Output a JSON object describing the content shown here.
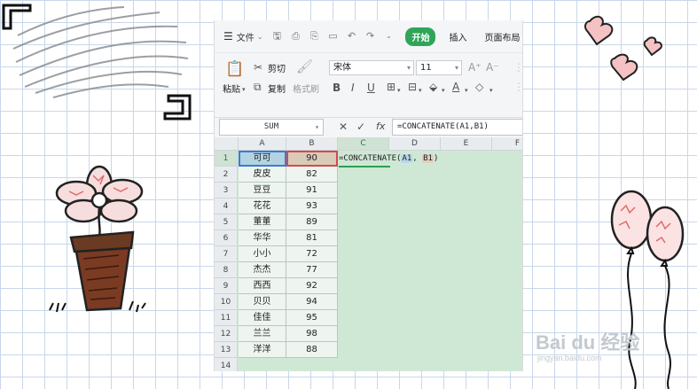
{
  "menubar": {
    "file_menu": "文件",
    "tabs": [
      {
        "label": "开始",
        "active": true
      },
      {
        "label": "插入",
        "active": false
      },
      {
        "label": "页面布局",
        "active": false
      }
    ],
    "quick_icons": [
      "save-icon",
      "print-preview-icon",
      "print-icon",
      "export-pdf-icon",
      "undo-icon",
      "redo-icon",
      "more-icon"
    ]
  },
  "ribbon": {
    "paste": "粘贴",
    "cut": "剪切",
    "copy": "复制",
    "format_painter": "格式刷",
    "font_name": "宋体",
    "font_size": "11"
  },
  "formula_bar": {
    "name_box": "SUM",
    "fx": "fx",
    "formula": "=CONCATENATE(A1,B1)"
  },
  "grid": {
    "columns": [
      "A",
      "B",
      "C",
      "D",
      "E",
      "F"
    ],
    "rows": [
      {
        "num": "1",
        "name": "可可",
        "score": "90"
      },
      {
        "num": "2",
        "name": "皮皮",
        "score": "82"
      },
      {
        "num": "3",
        "name": "豆豆",
        "score": "91"
      },
      {
        "num": "4",
        "name": "花花",
        "score": "93"
      },
      {
        "num": "5",
        "name": "董董",
        "score": "89"
      },
      {
        "num": "6",
        "name": "华华",
        "score": "81"
      },
      {
        "num": "7",
        "name": "小小",
        "score": "72"
      },
      {
        "num": "8",
        "name": "杰杰",
        "score": "77"
      },
      {
        "num": "9",
        "name": "西西",
        "score": "92"
      },
      {
        "num": "10",
        "name": "贝贝",
        "score": "94"
      },
      {
        "num": "11",
        "name": "佳佳",
        "score": "95"
      },
      {
        "num": "12",
        "name": "兰兰",
        "score": "98"
      },
      {
        "num": "13",
        "name": "洋洋",
        "score": "88"
      },
      {
        "num": "14",
        "name": "",
        "score": ""
      }
    ],
    "editing_cell": {
      "prefix": "=CONCATENATE(",
      "ref1": "A1",
      "sep": ", ",
      "ref2": "B1",
      "suffix": ")"
    }
  },
  "watermark": {
    "brand": "Bai du 经验",
    "url": "jingyan.baidu.com"
  },
  "colors": {
    "accent": "#2ea557",
    "grid_bg": "#cfe8d5",
    "ref_a": "#3a7bd5",
    "ref_b": "#d44a4a"
  }
}
